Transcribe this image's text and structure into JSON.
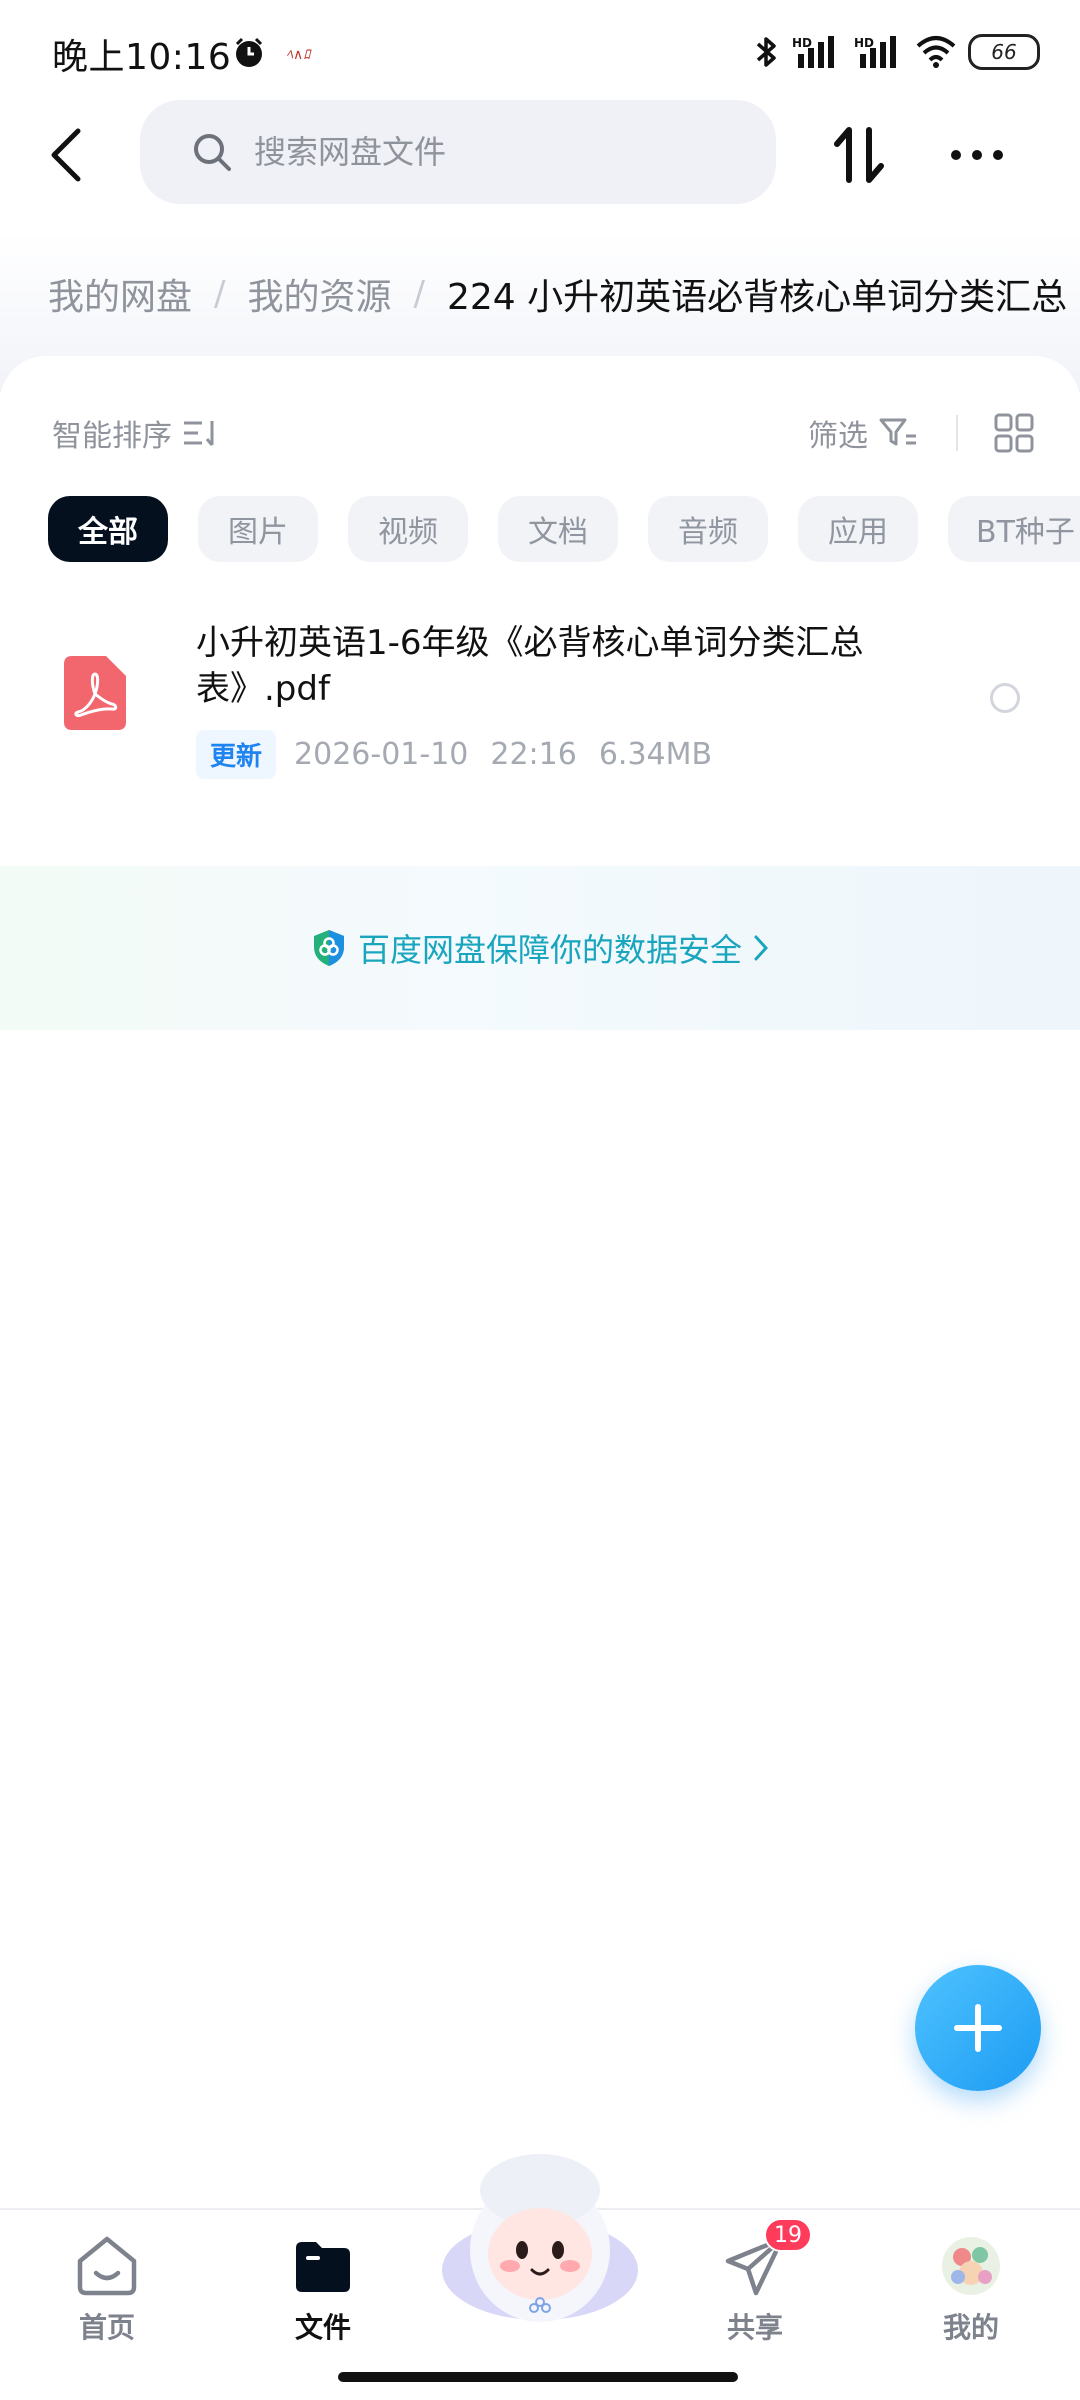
{
  "status_bar": {
    "time": "晚上10:16",
    "notification_text": "ﾍ∧ﾛ",
    "battery": "66"
  },
  "header": {
    "search_placeholder": "搜索网盘文件"
  },
  "breadcrumb": {
    "items": [
      "我的网盘",
      "我的资源"
    ],
    "current": "224  小升初英语必背核心单词分类汇总"
  },
  "toolbar": {
    "sort_label": "智能排序",
    "filter_label": "筛选"
  },
  "chips": [
    {
      "label": "全部",
      "active": true
    },
    {
      "label": "图片",
      "active": false
    },
    {
      "label": "视频",
      "active": false
    },
    {
      "label": "文档",
      "active": false
    },
    {
      "label": "音频",
      "active": false
    },
    {
      "label": "应用",
      "active": false
    },
    {
      "label": "BT种子",
      "active": false
    }
  ],
  "files": [
    {
      "name": "小升初英语1-6年级《必背核心单词分类汇总表》.pdf",
      "badge": "更新",
      "date": "2026-01-10",
      "time": "22:16",
      "size": "6.34MB",
      "type_icon": "pdf-icon"
    }
  ],
  "security_banner": {
    "text": "百度网盘保障你的数据安全"
  },
  "bottom_nav": {
    "home": "首页",
    "files": "文件",
    "share": "共享",
    "share_badge": "19",
    "mine": "我的"
  },
  "colors": {
    "accent": "#1f84f0",
    "active_chip": "#05101f",
    "security_text": "#19a5bd",
    "fab": "#1c9bf3",
    "badge": "#ff3b5c"
  }
}
